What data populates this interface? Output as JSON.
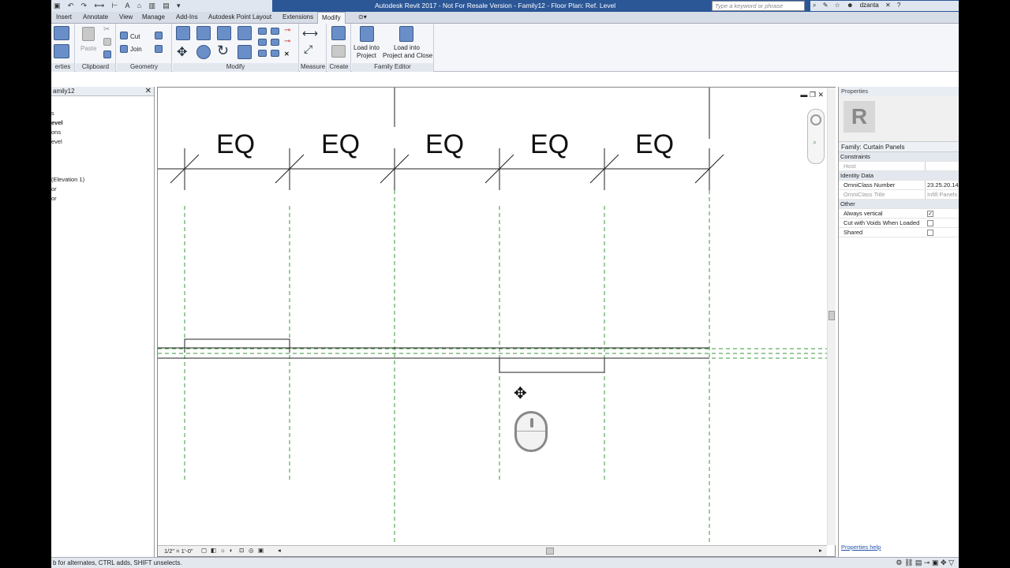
{
  "app": {
    "window_title": "Autodesk Revit 2017 - Not For Resale Version  -  Family12 - Floor Plan: Ref. Level",
    "search_placeholder": "Type a keyword or phrase",
    "user": "dzanta"
  },
  "ribbon": {
    "tabs": [
      "Insert",
      "Annotate",
      "View",
      "Manage",
      "Add-Ins",
      "Autodesk Point Layout",
      "Extensions",
      "Modify"
    ],
    "active_tab": "Modify",
    "panels": {
      "properties": "erties",
      "clipboard": "Clipboard",
      "geometry": "Geometry",
      "modify": "Modify",
      "measure": "Measure",
      "create": "Create",
      "family_editor": "Family Editor"
    },
    "buttons": {
      "paste": "Paste",
      "cut": "Cut",
      "join": "Join",
      "load_into_project_1": "Load into",
      "load_into_project_2": "Project",
      "load_close_1": "Load into",
      "load_close_2": "Project and Close"
    }
  },
  "browser": {
    "title": "amily12",
    "items": [
      "s",
      "evel",
      "ons",
      "evel",
      "",
      "(Elevation 1)",
      "or",
      "or"
    ]
  },
  "canvas": {
    "dimension_labels": [
      "EQ",
      "EQ",
      "EQ",
      "EQ",
      "EQ"
    ],
    "scale": "1/2\" = 1'-0\""
  },
  "properties": {
    "header": "Properties",
    "type_selector": "Family: Curtain Panels",
    "groups": {
      "constraints": "Constraints",
      "identity": "Identity Data",
      "other": "Other"
    },
    "rows": {
      "host": "Host",
      "omniclass_number": "OmniClass Number",
      "omniclass_number_value": "23.25.20.14.",
      "omniclass_title": "OmniClass Title",
      "omniclass_title_value": "Infill Panels",
      "always_vertical": "Always vertical",
      "cut_with_voids": "Cut with Voids When Loaded",
      "shared": "Shared"
    },
    "help_link": "Properties help"
  },
  "status": {
    "text": "b for alternates, CTRL adds, SHIFT unselects."
  }
}
